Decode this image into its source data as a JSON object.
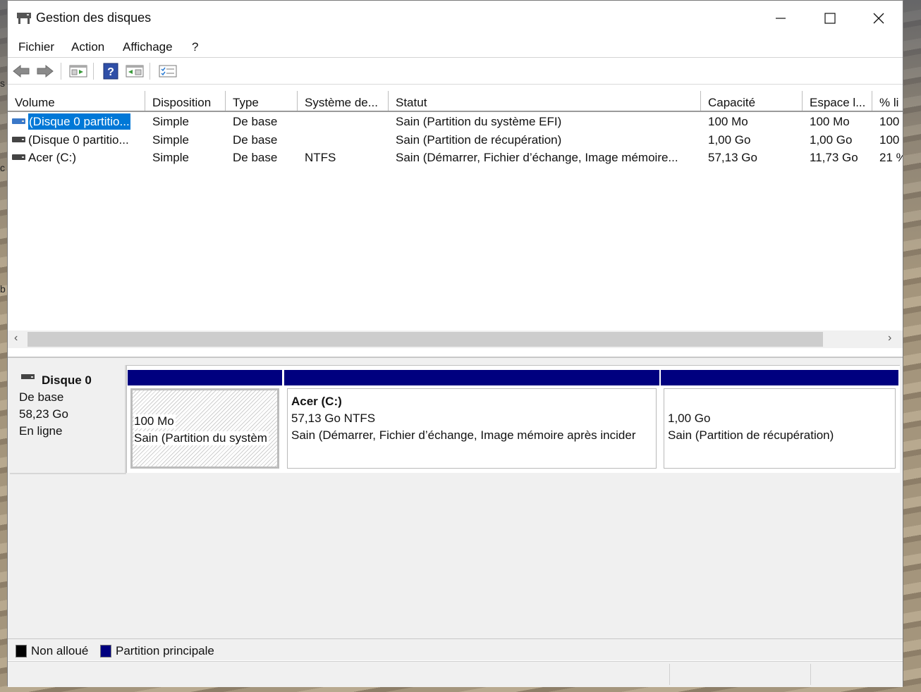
{
  "window": {
    "title": "Gestion des disques"
  },
  "menu": [
    "Fichier",
    "Action",
    "Affichage",
    "?"
  ],
  "columns": [
    "Volume",
    "Disposition",
    "Type",
    "Système de...",
    "Statut",
    "Capacité",
    "Espace l...",
    "% li"
  ],
  "volumes": [
    {
      "volume": "(Disque 0 partitio...",
      "disposition": "Simple",
      "type": "De base",
      "fs": "",
      "status": "Sain (Partition du système EFI)",
      "capacity": "100 Mo",
      "free": "100 Mo",
      "pct": "100",
      "selected": true
    },
    {
      "volume": "(Disque 0 partitio...",
      "disposition": "Simple",
      "type": "De base",
      "fs": "",
      "status": "Sain (Partition de récupération)",
      "capacity": "1,00 Go",
      "free": "1,00 Go",
      "pct": "100",
      "selected": false
    },
    {
      "volume": "Acer (C:)",
      "disposition": "Simple",
      "type": "De base",
      "fs": "NTFS",
      "status": "Sain (Démarrer, Fichier d’échange, Image mémoire...",
      "capacity": "57,13 Go",
      "free": "11,73 Go",
      "pct": "21 %",
      "selected": false
    }
  ],
  "disk": {
    "name": "Disque 0",
    "type": "De base",
    "size": "58,23 Go",
    "state": "En ligne"
  },
  "partitions": [
    {
      "name": "",
      "size": "100 Mo",
      "status": "Sain (Partition du systèm"
    },
    {
      "name": "Acer  (C:)",
      "size": "57,13 Go NTFS",
      "status": "Sain (Démarrer, Fichier d’échange, Image mémoire après incider"
    },
    {
      "name": "",
      "size": "1,00 Go",
      "status": "Sain (Partition de récupération)"
    }
  ],
  "legend": {
    "unallocated": "Non alloué",
    "primary": "Partition principale"
  },
  "colors": {
    "primary_partition": "#00007f",
    "unallocated": "#000000",
    "selection": "#0078d7"
  },
  "icons": [
    "app-disk-icon",
    "back-arrow-icon",
    "forward-arrow-icon",
    "console-tree-icon",
    "help-icon",
    "action-pane-icon",
    "properties-icon"
  ]
}
